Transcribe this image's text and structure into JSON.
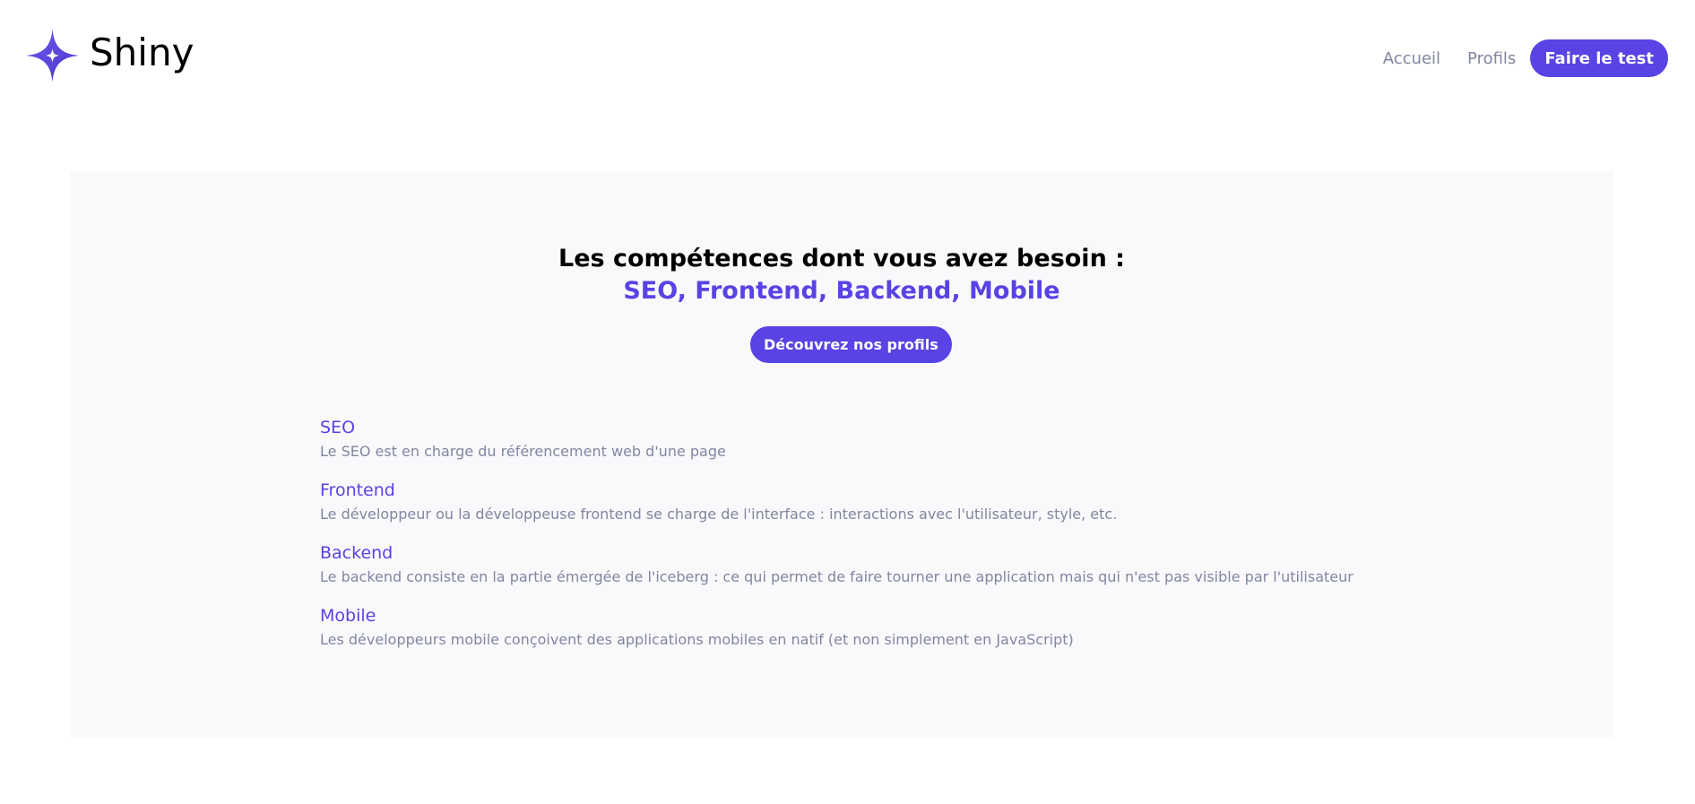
{
  "brand": {
    "name": "Shiny",
    "logo_icon": "four-point-star-icon",
    "accent_color": "#5843e4"
  },
  "nav": {
    "home_label": "Accueil",
    "profiles_label": "Profils",
    "test_label": "Faire le test"
  },
  "hero": {
    "title": "Les compétences dont vous avez besoin :",
    "skills_line": "SEO, Frontend, Backend, Mobile",
    "cta_label": "Découvrez nos profils"
  },
  "skills": [
    {
      "name": "SEO",
      "description": "Le SEO est en charge du référencement web d'une page"
    },
    {
      "name": "Frontend",
      "description": "Le développeur ou la développeuse frontend se charge de l'interface : interactions avec l'utilisateur, style, etc."
    },
    {
      "name": "Backend",
      "description": "Le backend consiste en la partie émergée de l'iceberg : ce qui permet de faire tourner une application mais qui n'est pas visible par l'utilisateur"
    },
    {
      "name": "Mobile",
      "description": "Les développeurs mobile conçoivent des applications mobiles en natif (et non simplement en JavaScript)"
    }
  ]
}
